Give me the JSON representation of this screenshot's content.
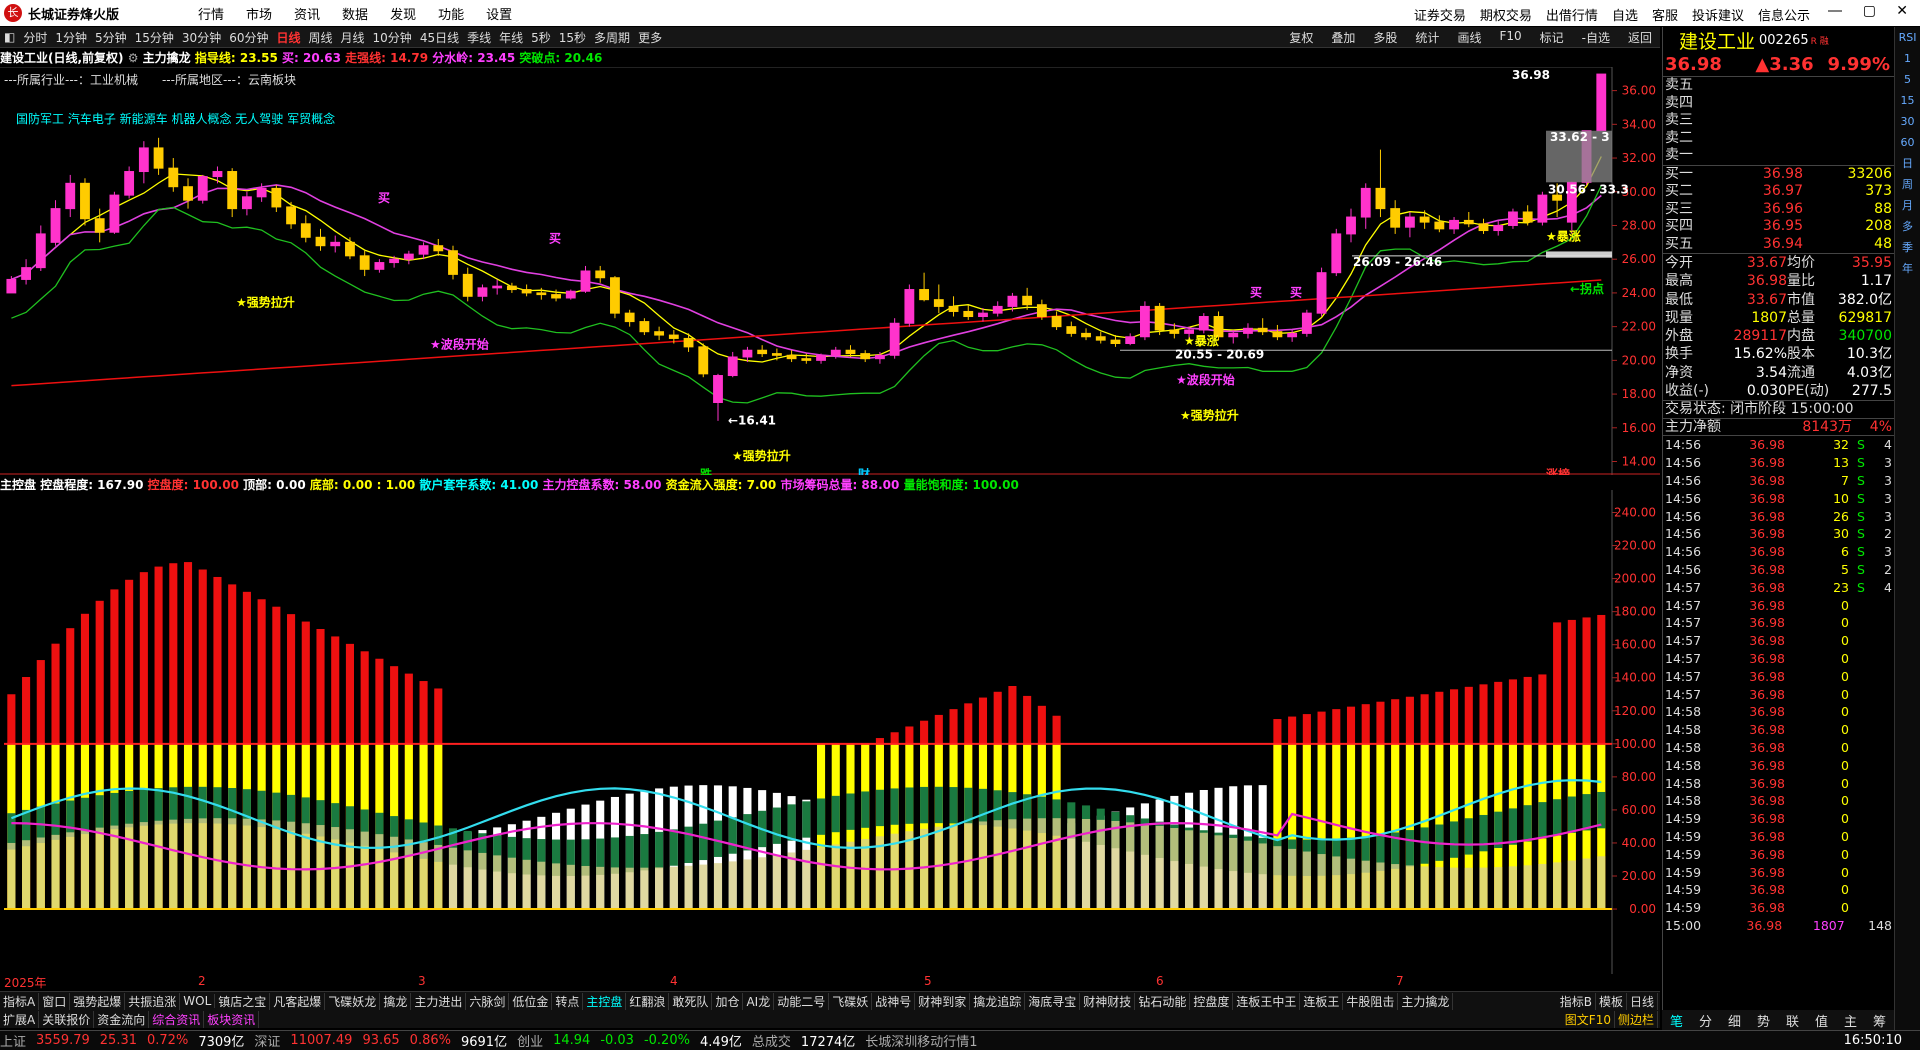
{
  "titlebar": {
    "app": "长城证券烽火版",
    "menu": [
      "行情",
      "市场",
      "资讯",
      "数据",
      "发现",
      "功能",
      "设置"
    ],
    "right": [
      "证券交易",
      "期权交易",
      "出借行情",
      "自选",
      "客服",
      "投诉建议",
      "信息公示"
    ]
  },
  "periods": [
    "分时",
    "1分钟",
    "5分钟",
    "15分钟",
    "30分钟",
    "60分钟",
    "日线",
    "周线",
    "月线",
    "10分钟",
    "45日线",
    "季线",
    "年线",
    "5秒",
    "15秒",
    "多周期",
    "更多"
  ],
  "active_period": "日线",
  "toolbar": [
    "复权",
    "叠加",
    "多股",
    "统计",
    "画线",
    "F10",
    "标记",
    "-自选",
    "返回"
  ],
  "stock": {
    "name": "建设工业",
    "code": "002265",
    "suffix": "R 融"
  },
  "chart_info": {
    "title": "建设工业(日线,前复权)",
    "indicator": "主力擒龙",
    "guide": "指导线: 23.55",
    "buy": "买: 20.63",
    "strong_stop": "走强线: 14.79",
    "water": "分水岭: 23.45",
    "breakout": "突破点: 20.46"
  },
  "industry": "---所属行业---：工业机械　　---所属地区---：云南板块",
  "concepts": "国防军工 汽车电子 新能源车 机器人概念 无人驾驶 军贸概念",
  "chart_data": [
    {
      "type": "candlestick",
      "title": "建设工业(日线,前复权)",
      "ylim": [
        14,
        37
      ],
      "yticks": [
        14,
        16,
        18,
        20,
        22,
        24,
        26,
        28,
        30,
        32,
        34,
        36
      ],
      "ohlc": [
        [
          24,
          25,
          24.5,
          24.8
        ],
        [
          24.8,
          26,
          24.5,
          25.5
        ],
        [
          25.5,
          28,
          25.3,
          27.5
        ],
        [
          27,
          29.5,
          26.8,
          29
        ],
        [
          29,
          31,
          28.5,
          30.5
        ],
        [
          30.5,
          30.8,
          28,
          28.4
        ],
        [
          28.4,
          29,
          27,
          27.6
        ],
        [
          27.6,
          30,
          27.5,
          29.8
        ],
        [
          29.8,
          31.5,
          29.6,
          31.2
        ],
        [
          31.2,
          33,
          30.5,
          32.6
        ],
        [
          32.6,
          33.2,
          31,
          31.4
        ],
        [
          31.4,
          32,
          30,
          30.3
        ],
        [
          30.3,
          30.8,
          29,
          29.5
        ],
        [
          29.5,
          31,
          29.3,
          30.9
        ],
        [
          30.9,
          31.5,
          30.5,
          31.2
        ],
        [
          31.2,
          31.4,
          28.5,
          29
        ],
        [
          29,
          30,
          28.6,
          29.7
        ],
        [
          29.7,
          30.5,
          29.4,
          30.2
        ],
        [
          30.2,
          30.4,
          28.8,
          29.1
        ],
        [
          29.1,
          29.4,
          27.8,
          28.1
        ],
        [
          28.1,
          28.6,
          27,
          27.3
        ],
        [
          27.3,
          27.8,
          26.5,
          26.8
        ],
        [
          26.8,
          27.4,
          26.4,
          27
        ],
        [
          27,
          27.3,
          26,
          26.2
        ],
        [
          26.2,
          26.5,
          25,
          25.4
        ],
        [
          25.4,
          26,
          25.2,
          25.8
        ],
        [
          25.8,
          26.2,
          25.5,
          26
        ],
        [
          26,
          26.5,
          25.7,
          26.3
        ],
        [
          26.3,
          27,
          26,
          26.8
        ],
        [
          26.8,
          27.2,
          26.2,
          26.5
        ],
        [
          26.5,
          26.8,
          24.8,
          25.1
        ],
        [
          25.1,
          25.5,
          23.5,
          23.8
        ],
        [
          23.8,
          24.5,
          23.5,
          24.3
        ],
        [
          24.3,
          24.8,
          23.9,
          24.4
        ],
        [
          24.4,
          24.6,
          24,
          24.2
        ],
        [
          24.2,
          24.5,
          23.8,
          24
        ],
        [
          24,
          24.3,
          23.6,
          23.9
        ],
        [
          23.9,
          24.2,
          23.5,
          23.7
        ],
        [
          23.7,
          24.2,
          23.6,
          24.1
        ],
        [
          24.1,
          25.6,
          24,
          25.3
        ],
        [
          25.3,
          25.6,
          24.6,
          24.9
        ],
        [
          24.9,
          25,
          22.5,
          22.8
        ],
        [
          22.8,
          23,
          22,
          22.3
        ],
        [
          22.3,
          22.5,
          21.5,
          21.7
        ],
        [
          21.7,
          22,
          21.2,
          21.5
        ],
        [
          21.5,
          21.8,
          21,
          21.3
        ],
        [
          21.3,
          21.6,
          20.5,
          20.8
        ],
        [
          20.8,
          21,
          19,
          19.2
        ],
        [
          17.5,
          19.2,
          16.41,
          19.1
        ],
        [
          19.1,
          20.5,
          19,
          20.2
        ],
        [
          20.2,
          20.8,
          19.9,
          20.6
        ],
        [
          20.6,
          20.9,
          20.2,
          20.4
        ],
        [
          20.4,
          20.7,
          20,
          20.3
        ],
        [
          20.3,
          20.6,
          19.9,
          20.1
        ],
        [
          20.1,
          20.4,
          19.8,
          20
        ],
        [
          20,
          20.4,
          19.8,
          20.3
        ],
        [
          20.3,
          20.8,
          20.1,
          20.6
        ],
        [
          20.6,
          20.9,
          20.2,
          20.4
        ],
        [
          20.4,
          20.6,
          19.9,
          20.1
        ],
        [
          20.1,
          20.5,
          19.8,
          20.3
        ],
        [
          20.3,
          22.5,
          20.1,
          22.2
        ],
        [
          22.2,
          24.5,
          22,
          24.2
        ],
        [
          24.2,
          25.2,
          23.5,
          23.6
        ],
        [
          23.6,
          24.5,
          22.8,
          23.2
        ],
        [
          23.2,
          23.8,
          22.6,
          22.9
        ],
        [
          22.9,
          23.3,
          22.4,
          22.6
        ],
        [
          22.6,
          23.1,
          22.3,
          22.8
        ],
        [
          22.8,
          23.5,
          22.6,
          23.2
        ],
        [
          23.2,
          24,
          22.9,
          23.8
        ],
        [
          23.8,
          24.3,
          23,
          23.3
        ],
        [
          23.3,
          23.6,
          22.4,
          22.6
        ],
        [
          22.6,
          22.9,
          21.8,
          22
        ],
        [
          22,
          22.3,
          21.4,
          21.6
        ],
        [
          21.6,
          21.9,
          21.2,
          21.4
        ],
        [
          21.4,
          21.7,
          21,
          21.2
        ],
        [
          21.2,
          21.5,
          20.8,
          21
        ],
        [
          21,
          21.6,
          20.9,
          21.4
        ],
        [
          21.4,
          23.5,
          21.2,
          23.2
        ],
        [
          23.2,
          23.4,
          21.5,
          21.8
        ],
        [
          21.8,
          22.2,
          21.3,
          21.6
        ],
        [
          21.6,
          22,
          21.2,
          21.8
        ],
        [
          21.8,
          22.8,
          21.6,
          22.6
        ],
        [
          22.6,
          22.9,
          21.2,
          21.4
        ],
        [
          21.4,
          21.8,
          21,
          21.6
        ],
        [
          21.6,
          22.2,
          21.3,
          21.9
        ],
        [
          21.9,
          22.5,
          21.5,
          21.7
        ],
        [
          21.7,
          22.1,
          21.2,
          21.4
        ],
        [
          21.4,
          21.8,
          21.1,
          21.6
        ],
        [
          21.6,
          23,
          21.4,
          22.8
        ],
        [
          22.8,
          25.5,
          22.6,
          25.2
        ],
        [
          25.2,
          27.8,
          25,
          27.5
        ],
        [
          27.5,
          29,
          27,
          28.5
        ],
        [
          28.5,
          30.5,
          27.8,
          30.2
        ],
        [
          30.2,
          32.5,
          28.5,
          29
        ],
        [
          29,
          29.5,
          27.5,
          27.9
        ],
        [
          27.9,
          28.8,
          27.3,
          28.5
        ],
        [
          28.5,
          28.9,
          27.8,
          28.2
        ],
        [
          28.2,
          28.6,
          27.6,
          27.8
        ],
        [
          27.8,
          28.5,
          27.5,
          28.3
        ],
        [
          28.3,
          28.8,
          27.9,
          28.1
        ],
        [
          28.1,
          28.4,
          27.5,
          27.7
        ],
        [
          27.7,
          28.3,
          27.4,
          28
        ],
        [
          28,
          29,
          27.8,
          28.8
        ],
        [
          28.8,
          29.2,
          28,
          28.2
        ],
        [
          28.2,
          30,
          28,
          29.8
        ],
        [
          29.8,
          30.5,
          28.5,
          29.5
        ],
        [
          28.2,
          30.6,
          27.5,
          30.56
        ],
        [
          30.56,
          33.62,
          30.4,
          33.62
        ],
        [
          33.62,
          36.98,
          33.62,
          36.98
        ]
      ],
      "annotations": [
        "36.98",
        "33.62 - 3",
        "30.56 - 33.3",
        "26.09 - 26.46",
        "20.55 - 20.69",
        "←16.41",
        "★强势拉升",
        "★波段开始",
        "★波段开始",
        "★强势拉升",
        "★强势拉升",
        "★暴涨",
        "★暴涨",
        "←拐点",
        "买",
        "买",
        "买",
        "买",
        "跌",
        "财",
        "涨榜"
      ]
    },
    {
      "type": "bar",
      "title": "主控盘",
      "yticks": [
        0,
        20,
        40,
        60,
        80,
        100,
        120,
        140,
        160,
        180,
        200,
        220,
        240
      ],
      "info": [
        "主控盘",
        "控盘程度: 167.90",
        "控盘度: 100.00",
        "顶部: 0.00",
        "底部: 0.00",
        ": 1.00",
        "散户套牢系数: 41.00",
        "主力控盘系数: 58.00",
        "资金流入强度: 7.00",
        "市场筹码总量: 88.00",
        "量能饱和度: 100.00"
      ]
    }
  ],
  "time_axis": [
    "2025年",
    "2",
    "3",
    "4",
    "5",
    "6",
    "7"
  ],
  "tabs1": [
    "指标A",
    "窗口",
    "强势起爆",
    "共振追涨",
    "WOL",
    "镇店之宝",
    "凡客起爆",
    "飞碟妖龙",
    "擒龙",
    "主力进出",
    "六脉剑",
    "低位金",
    "转点",
    "主控盘",
    "红翻浪",
    "敢死队",
    "加仓",
    "AI龙",
    "动能二号",
    "飞碟妖",
    "战神号",
    "财神到家",
    "擒龙追踪",
    "海底寻宝",
    "财神财技",
    "钻石动能",
    "控盘度",
    "连板王中王",
    "连板王",
    "牛股阻击",
    "主力擒龙"
  ],
  "tabs1_right": [
    "指标B",
    "模板",
    "日线"
  ],
  "tabs2": [
    "扩展A",
    "关联报价",
    "资金流向",
    "综合资讯",
    "板块资讯"
  ],
  "tabs2_right": [
    "图文F10",
    "侧边栏"
  ],
  "quote": {
    "price": "36.98",
    "change": "▲3.36",
    "pct": "9.99%",
    "sell": [
      {
        "label": "卖五"
      },
      {
        "label": "卖四"
      },
      {
        "label": "卖三"
      },
      {
        "label": "卖二"
      },
      {
        "label": "卖一"
      }
    ],
    "buy": [
      {
        "label": "买一",
        "price": "36.98",
        "vol": "33206"
      },
      {
        "label": "买二",
        "price": "36.97",
        "vol": "373"
      },
      {
        "label": "买三",
        "price": "36.96",
        "vol": "88"
      },
      {
        "label": "买四",
        "price": "36.95",
        "vol": "208"
      },
      {
        "label": "买五",
        "price": "36.94",
        "vol": "48"
      }
    ],
    "stats": [
      [
        "今开",
        "33.67",
        "均价",
        "35.95"
      ],
      [
        "最高",
        "36.98",
        "量比",
        "1.17"
      ],
      [
        "最低",
        "33.67",
        "市值",
        "382.0亿"
      ],
      [
        "现量",
        "1807",
        "总量",
        "629817"
      ],
      [
        "外盘",
        "289117",
        "内盘",
        "340700"
      ],
      [
        "换手",
        "15.62%",
        "股本",
        "10.3亿"
      ],
      [
        "净资",
        "3.54",
        "流通",
        "4.03亿"
      ],
      [
        "收益(-)",
        "0.030",
        "PE(动)",
        "277.5"
      ]
    ],
    "state": "交易状态: 闭市阶段 15:00:00",
    "net_label": "主力净额",
    "net_value": "8143万",
    "net_pct": "4%"
  },
  "ticks": [
    [
      "14:56",
      "36.98",
      "32",
      "S",
      "4"
    ],
    [
      "14:56",
      "36.98",
      "13",
      "S",
      "3"
    ],
    [
      "14:56",
      "36.98",
      "7",
      "S",
      "3"
    ],
    [
      "14:56",
      "36.98",
      "10",
      "S",
      "3"
    ],
    [
      "14:56",
      "36.98",
      "26",
      "S",
      "3"
    ],
    [
      "14:56",
      "36.98",
      "30",
      "S",
      "2"
    ],
    [
      "14:56",
      "36.98",
      "6",
      "S",
      "3"
    ],
    [
      "14:56",
      "36.98",
      "5",
      "S",
      "2"
    ],
    [
      "14:57",
      "36.98",
      "23",
      "S",
      "4"
    ],
    [
      "14:57",
      "36.98",
      "0",
      "",
      ""
    ],
    [
      "14:57",
      "36.98",
      "0",
      "",
      ""
    ],
    [
      "14:57",
      "36.98",
      "0",
      "",
      ""
    ],
    [
      "14:57",
      "36.98",
      "0",
      "",
      ""
    ],
    [
      "14:57",
      "36.98",
      "0",
      "",
      ""
    ],
    [
      "14:57",
      "36.98",
      "0",
      "",
      ""
    ],
    [
      "14:58",
      "36.98",
      "0",
      "",
      ""
    ],
    [
      "14:58",
      "36.98",
      "0",
      "",
      ""
    ],
    [
      "14:58",
      "36.98",
      "0",
      "",
      ""
    ],
    [
      "14:58",
      "36.98",
      "0",
      "",
      ""
    ],
    [
      "14:58",
      "36.98",
      "0",
      "",
      ""
    ],
    [
      "14:58",
      "36.98",
      "0",
      "",
      ""
    ],
    [
      "14:59",
      "36.98",
      "0",
      "",
      ""
    ],
    [
      "14:59",
      "36.98",
      "0",
      "",
      ""
    ],
    [
      "14:59",
      "36.98",
      "0",
      "",
      ""
    ],
    [
      "14:59",
      "36.98",
      "0",
      "",
      ""
    ],
    [
      "14:59",
      "36.98",
      "0",
      "",
      ""
    ],
    [
      "14:59",
      "36.98",
      "0",
      "",
      ""
    ],
    [
      "15:00",
      "36.98",
      "1807",
      "",
      "148"
    ]
  ],
  "right_tabs": [
    "笔",
    "分",
    "细",
    "势",
    "联",
    "值",
    "主",
    "筹"
  ],
  "vstrip": [
    "RSI",
    "1",
    "5",
    "15",
    "30",
    "60",
    "日",
    "周",
    "月",
    "多",
    "季",
    "年"
  ],
  "statusbar": {
    "sh_label": "上证",
    "sh": "3559.79",
    "sh_chg": "25.31",
    "sh_pct": "0.72%",
    "sh_amt": "7309亿",
    "sz_label": "深证",
    "sz": "11007.49",
    "sz_chg": "93.65",
    "sz_pct": "0.86%",
    "sz_amt": "9691亿",
    "cy_label": "创业",
    "cy": "14.94",
    "cy_chg": "-0.03",
    "cy_pct": "-0.20%",
    "cy_amt": "4.49亿",
    "total_label": "总成交",
    "total": "17274亿",
    "msg": "长城深圳移动行情1",
    "time": "16:50:10"
  }
}
